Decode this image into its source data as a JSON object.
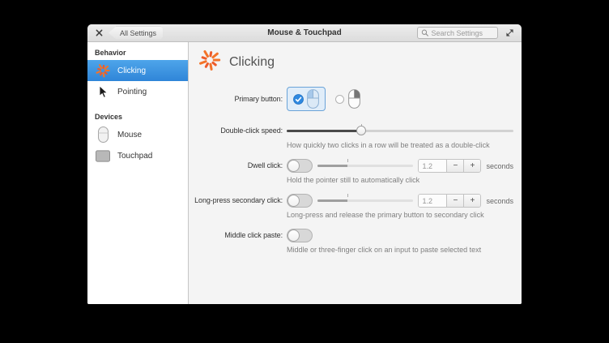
{
  "header": {
    "back_label": "All Settings",
    "title": "Mouse & Touchpad",
    "search_placeholder": "Search Settings"
  },
  "sidebar": {
    "sections": [
      {
        "heading": "Behavior",
        "items": [
          {
            "label": "Clicking",
            "icon": "starburst-icon",
            "selected": true
          },
          {
            "label": "Pointing",
            "icon": "cursor-icon",
            "selected": false
          }
        ]
      },
      {
        "heading": "Devices",
        "items": [
          {
            "label": "Mouse",
            "icon": "mouse-icon",
            "selected": false
          },
          {
            "label": "Touchpad",
            "icon": "touchpad-icon",
            "selected": false
          }
        ]
      }
    ]
  },
  "main": {
    "title": "Clicking",
    "primary": {
      "label": "Primary button:",
      "options": [
        {
          "name": "left-button-mouse",
          "selected": true
        },
        {
          "name": "right-button-mouse",
          "selected": false
        }
      ]
    },
    "double_click": {
      "label": "Double-click speed:",
      "help": "How quickly two clicks in a row will be treated as a double-click",
      "percent": 33
    },
    "dwell": {
      "label": "Dwell click:",
      "help": "Hold the pointer still to automatically click",
      "toggle": "off",
      "percent": 31,
      "value": "1.2",
      "minus": "−",
      "plus": "+",
      "unit": "seconds"
    },
    "long_press": {
      "label": "Long-press secondary click:",
      "help": "Long-press and release the primary button to secondary click",
      "toggle": "off",
      "percent": 31,
      "value": "1.2",
      "minus": "−",
      "plus": "+",
      "unit": "seconds"
    },
    "middle_paste": {
      "label": "Middle click paste:",
      "help": "Middle or three-finger click on an input to paste selected text",
      "toggle": "off"
    }
  },
  "colors": {
    "selection_blue_top": "#4ea5ea",
    "selection_blue_bottom": "#2f85d8",
    "accent_blue": "#2f89e0",
    "icon_orange": "#f37329",
    "window_bg": "#f4f4f4",
    "sidebar_bg": "#ffffff",
    "headerbar_bg": "#e4e4e4"
  }
}
